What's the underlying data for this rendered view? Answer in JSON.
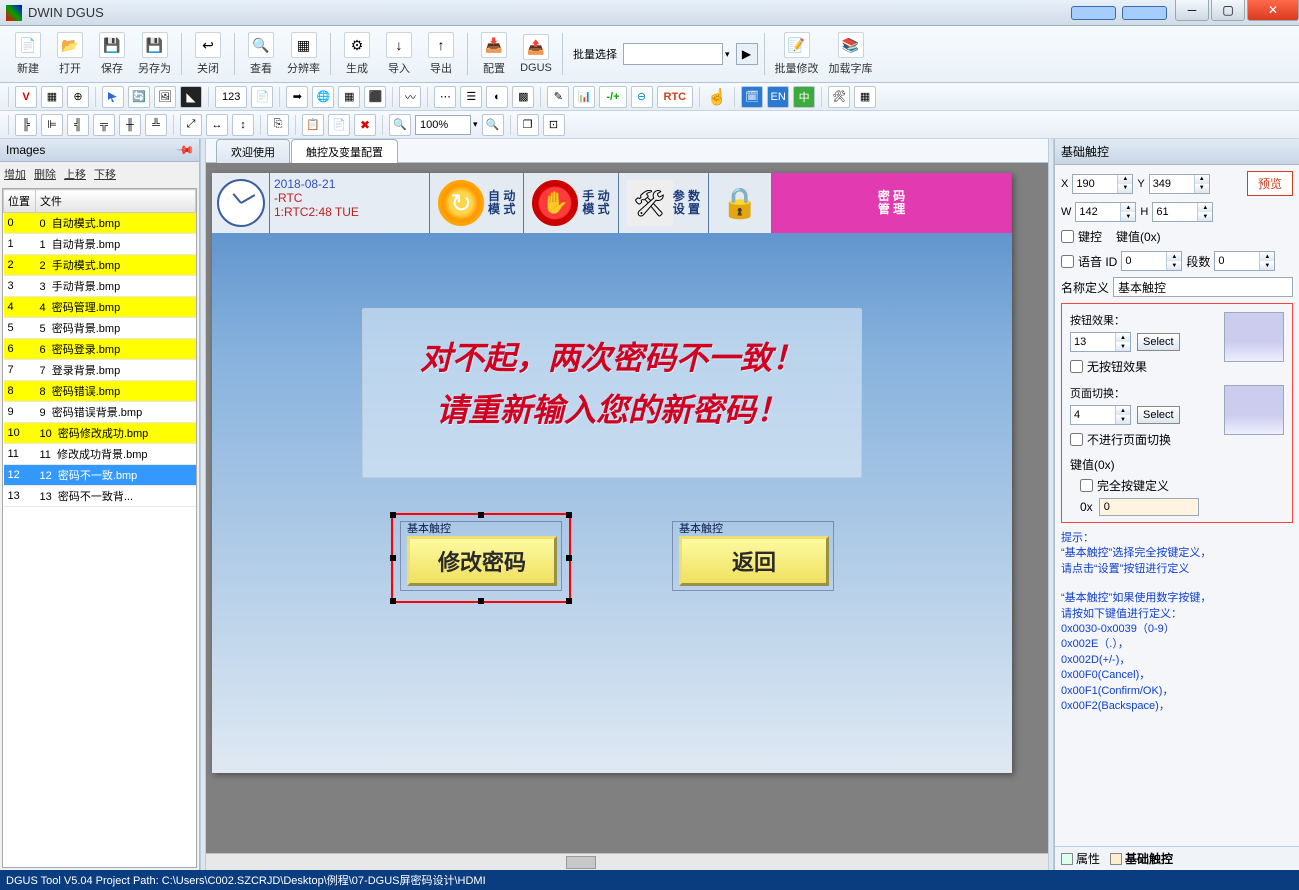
{
  "title": "DWIN DGUS",
  "ribbon": {
    "items": [
      {
        "icon": "📄",
        "label": "新建"
      },
      {
        "icon": "📂",
        "label": "打开"
      },
      {
        "icon": "💾",
        "label": "保存"
      },
      {
        "icon": "💾",
        "label": "另存为"
      },
      {
        "sep": true
      },
      {
        "icon": "↩",
        "label": "关闭"
      },
      {
        "sep": true
      },
      {
        "icon": "🔍",
        "label": "查看"
      },
      {
        "icon": "▦",
        "label": "分辨率"
      },
      {
        "sep": true
      },
      {
        "icon": "⚙",
        "label": "生成"
      },
      {
        "icon": "↓",
        "label": "导入"
      },
      {
        "icon": "↑",
        "label": "导出"
      },
      {
        "sep": true
      },
      {
        "icon": "📥",
        "label": "配置"
      },
      {
        "icon": "📤",
        "label": "DGUS"
      }
    ],
    "batch_label": "批量选择",
    "batch_items": [
      {
        "icon": "📝",
        "label": "批量修改"
      },
      {
        "icon": "📚",
        "label": "加载字库"
      }
    ]
  },
  "toolrow2_zoom": "100%",
  "left": {
    "header": "Images",
    "btns": [
      "增加",
      "删除",
      "上移",
      "下移"
    ],
    "cols": [
      "位置",
      "文件"
    ],
    "rows": [
      {
        "pos": "0",
        "prefix": "0",
        "file": "自动模式.bmp",
        "cls": "yellow"
      },
      {
        "pos": "1",
        "prefix": "1",
        "file": "自动背景.bmp",
        "cls": ""
      },
      {
        "pos": "2",
        "prefix": "2",
        "file": "手动模式.bmp",
        "cls": "yellow"
      },
      {
        "pos": "3",
        "prefix": "3",
        "file": "手动背景.bmp",
        "cls": ""
      },
      {
        "pos": "4",
        "prefix": "4",
        "file": "密码管理.bmp",
        "cls": "yellow"
      },
      {
        "pos": "5",
        "prefix": "5",
        "file": "密码背景.bmp",
        "cls": ""
      },
      {
        "pos": "6",
        "prefix": "6",
        "file": "密码登录.bmp",
        "cls": "yellow"
      },
      {
        "pos": "7",
        "prefix": "7",
        "file": "登录背景.bmp",
        "cls": ""
      },
      {
        "pos": "8",
        "prefix": "8",
        "file": "密码错误.bmp",
        "cls": "yellow"
      },
      {
        "pos": "9",
        "prefix": "9",
        "file": "密码错误背景.bmp",
        "cls": ""
      },
      {
        "pos": "10",
        "prefix": "10",
        "file": "密码修改成功.bmp",
        "cls": "yellow"
      },
      {
        "pos": "11",
        "prefix": "11",
        "file": "修改成功背景.bmp",
        "cls": ""
      },
      {
        "pos": "12",
        "prefix": "12",
        "file": "密码不一致.bmp",
        "cls": "sel"
      },
      {
        "pos": "13",
        "prefix": "13",
        "file": "密码不一致背...",
        "cls": ""
      }
    ]
  },
  "tabs": [
    "欢迎使用",
    "触控及变量配置"
  ],
  "canvas": {
    "rtc_date": "2018-08-21",
    "rtc_label": "-RTC",
    "rtc_time": "1:RTC2:48 TUE",
    "modes": [
      {
        "t1": "自 动",
        "t2": "模 式"
      },
      {
        "t1": "手 动",
        "t2": "模 式"
      },
      {
        "t1": "参 数",
        "t2": "设 置"
      },
      {
        "t1": "密 码",
        "t2": "管 理"
      }
    ],
    "msg1": "对不起，两次密码不一致！",
    "msg2": "请重新输入您的新密码！",
    "touch_label": "基本触控",
    "btn1": "修改密码",
    "btn2": "返回"
  },
  "right": {
    "header": "基础触控",
    "x": "190",
    "y": "349",
    "w": "142",
    "h": "61",
    "preview": "预览",
    "key_ctrl": "键控",
    "key_val": "键值(0x)",
    "voice": "语音 ID",
    "voice_id": "0",
    "seg_label": "段数",
    "seg": "0",
    "name_label": "名称定义",
    "name_val": "基本触控",
    "btn_effect_label": "按钮效果：",
    "btn_effect_val": "13",
    "select": "Select",
    "no_btn_effect": "无按钮效果",
    "page_switch_label": "页面切换：",
    "page_switch_val": "4",
    "no_page_switch": "不进行页面切换",
    "keyval_label": "键值(0x)",
    "full_key": "完全按键定义",
    "ox_label": "0x",
    "ox_val": "0",
    "hint1": "提示：\n“基本触控”选择完全按键定义，\n请点击“设置”按钮进行定义",
    "hint2": "“基本触控”如果使用数字按键，\n请按如下键值进行定义：\n0x0030-0x0039（0-9）\n0x002E（.），\n0x002D(+/-)，\n0x00F0(Cancel)，\n0x00F1(Confirm/OK)，\n0x00F2(Backspace)，",
    "bottom_tabs": [
      "属性",
      "基础触控"
    ]
  },
  "status": "DGUS Tool V5.04  Project Path: C:\\Users\\C002.SZCRJD\\Desktop\\例程\\07-DGUS屏密码设计\\HDMI"
}
